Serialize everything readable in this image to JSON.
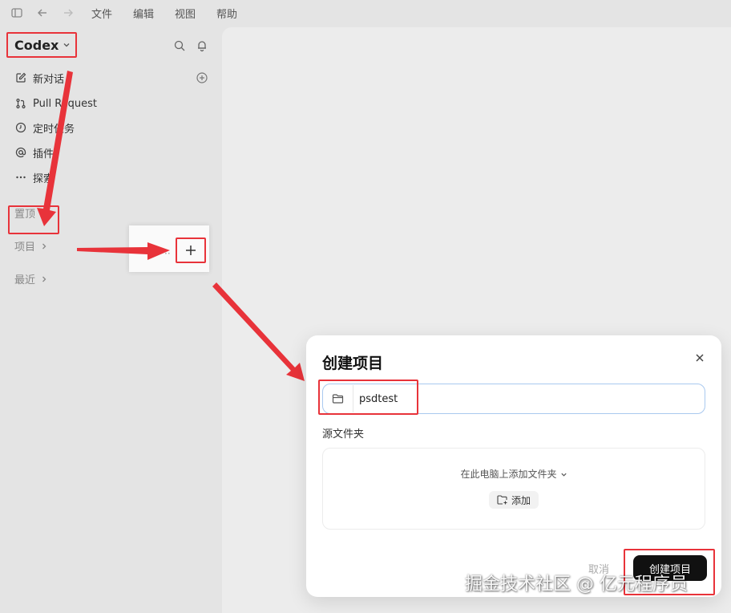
{
  "menubar": {
    "items": [
      "文件",
      "编辑",
      "视图",
      "帮助"
    ]
  },
  "sidebar": {
    "brand": "Codex",
    "nav": [
      {
        "label": "新对话",
        "icon": "edit-icon"
      },
      {
        "label": "Pull Request",
        "icon": "pull-request-icon"
      },
      {
        "label": "定时任务",
        "icon": "clock-icon"
      },
      {
        "label": "插件",
        "icon": "at-icon"
      },
      {
        "label": "探索",
        "icon": "more-icon"
      }
    ],
    "sections": {
      "pinned": "置顶",
      "projects": "项目",
      "recent": "最近"
    }
  },
  "popup": {
    "dots": "··"
  },
  "dialog": {
    "title": "创建项目",
    "name_value": "psdtest",
    "source_label": "源文件夹",
    "source_hint": "在此电脑上添加文件夹",
    "add_label": "添加",
    "cancel_label": "取消",
    "create_label": "创建项目"
  },
  "watermark": "掘金技术社区 @ 亿元程序员",
  "colors": {
    "highlight": "#e8333a",
    "primary_button": "#111111",
    "field_border": "#a9c9ef"
  }
}
